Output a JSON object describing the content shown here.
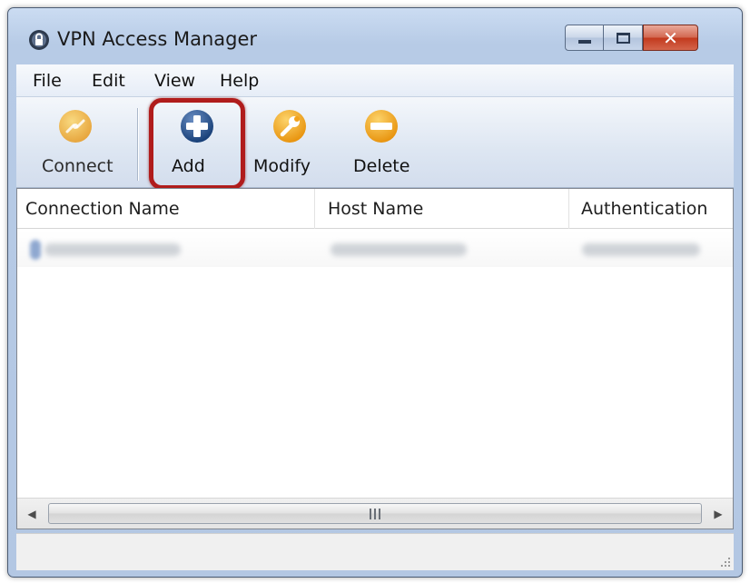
{
  "window": {
    "title": "VPN Access Manager",
    "app_icon": "vpn-padlock-icon",
    "caption_buttons": [
      "minimize",
      "maximize",
      "close"
    ]
  },
  "menu": {
    "items": [
      "File",
      "Edit",
      "View",
      "Help"
    ]
  },
  "toolbar": {
    "buttons": [
      {
        "label": "Connect",
        "icon": "connect-icon",
        "enabled": false
      },
      {
        "label": "Add",
        "icon": "plus-icon",
        "enabled": true,
        "highlighted": true
      },
      {
        "label": "Modify",
        "icon": "wrench-icon",
        "enabled": true
      },
      {
        "label": "Delete",
        "icon": "minus-icon",
        "enabled": true
      }
    ]
  },
  "list": {
    "columns": [
      "Connection Name",
      "Host Name",
      "Authentication"
    ],
    "rows_redacted": 1
  },
  "scrollbar": {
    "grip_glyph": "III"
  },
  "colors": {
    "highlight": "#b01c1c",
    "orange_icon": "#f2a21b",
    "blue_icon": "#1f4f8f",
    "close_button": "#c2391d"
  }
}
